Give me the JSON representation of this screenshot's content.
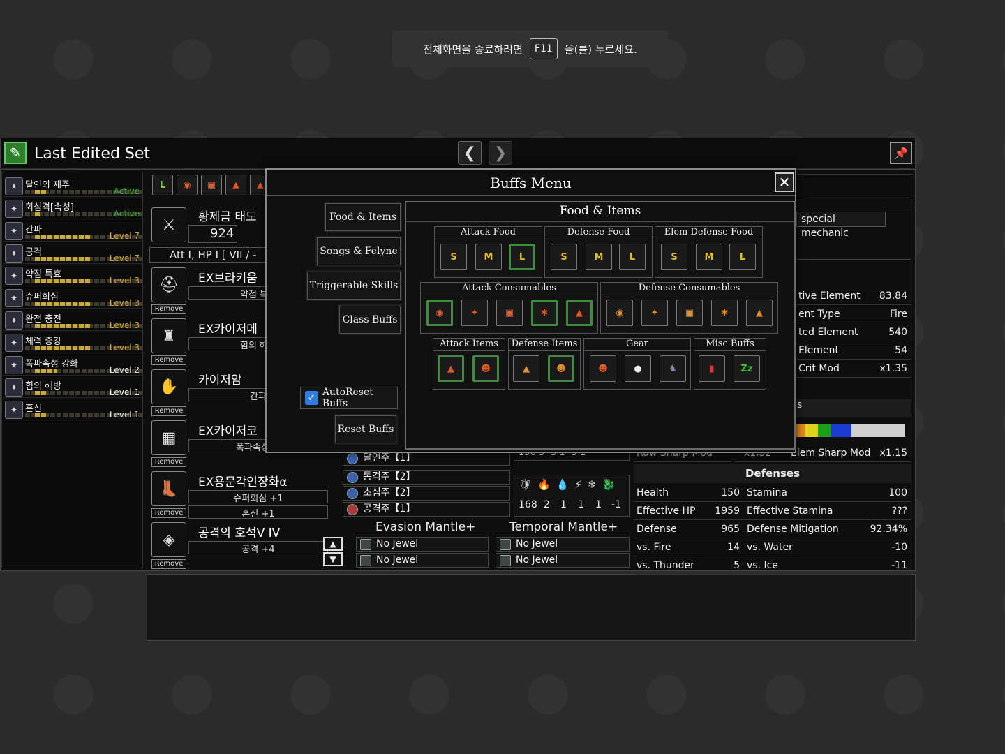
{
  "fullscreen_hint": {
    "before": "전체화면을 종료하려면",
    "key": "F11",
    "after": "을(를) 누르세요."
  },
  "window": {
    "title": "Last Edited Set",
    "prev": "❮",
    "next": "❯"
  },
  "skills": [
    {
      "name": "달인의 재주",
      "status": "Active",
      "fill": 0.2,
      "color": "#3ab03a"
    },
    {
      "name": "회심격[속성]",
      "status": "Active",
      "fill": 0.1,
      "color": "#3ab03a"
    },
    {
      "name": "간파",
      "status": "Level 7",
      "fill": 1.0,
      "color": "#d4a530"
    },
    {
      "name": "공격",
      "status": "Level 7",
      "fill": 1.0,
      "color": "#d4a530"
    },
    {
      "name": "약점 특효",
      "status": "Level 3",
      "fill": 1.0,
      "color": "#d4a530"
    },
    {
      "name": "슈퍼회심",
      "status": "Level 3",
      "fill": 1.0,
      "color": "#d4a530"
    },
    {
      "name": "완전 충전",
      "status": "Level 3",
      "fill": 1.0,
      "color": "#d4a530"
    },
    {
      "name": "체력 증강",
      "status": "Level 3",
      "fill": 1.0,
      "color": "#d4a530"
    },
    {
      "name": "폭파속성 강화",
      "status": "Level 2",
      "fill": 0.4,
      "color": "#e8e8e8"
    },
    {
      "name": "힘의 해방",
      "status": "Level 1",
      "fill": 0.2,
      "color": "#e8e8e8"
    },
    {
      "name": "혼신",
      "status": "Level 1",
      "fill": 0.2,
      "color": "#e8e8e8"
    }
  ],
  "weapon": {
    "name": "황제금 태도",
    "attack": "924",
    "att_row": "Att I, HP I [ VII / -"
  },
  "gear": [
    {
      "name": "EX브라키움",
      "skill1": "약점 특효",
      "skill2": ""
    },
    {
      "name": "EX카이저메",
      "skill1": "힘의 해방",
      "skill2": ""
    },
    {
      "name": "카이저암",
      "skill1": "간파",
      "skill2": ""
    },
    {
      "name": "EX카이저코",
      "skill1": "폭파속성 강",
      "skill2": ""
    },
    {
      "name": "EX용문각인장화α",
      "skill1": "슈퍼회심 +1",
      "skill2": "혼신 +1"
    },
    {
      "name": "공격의 호석V IV",
      "skill1": "공격 +4",
      "skill2": ""
    }
  ],
  "remove_label": "Remove",
  "jewels": [
    "달인주【1】",
    "통격주【2】",
    "초심주【2】",
    "공격주【1】"
  ],
  "mantles": {
    "m1": "Evasion Mantle+",
    "m2": "Temporal Mantle+",
    "no_jewel": "No Jewel"
  },
  "resist_row": [
    "168",
    "2",
    "1",
    "1",
    "1",
    "-1"
  ],
  "resist_partial": "156  3  -3  1  -3  1",
  "stats_top": [
    {
      "label": "tive Element",
      "value": "83.84"
    },
    {
      "label": "ent Type",
      "value": "Fire"
    },
    {
      "label": "ted Element",
      "value": "540"
    },
    {
      "label": "Element",
      "value": "54"
    },
    {
      "label": "Crit Mod",
      "value": "x1.35"
    }
  ],
  "special_mechanic": "special mechanic",
  "stats_sharp": {
    "label1": "Raw Sharp Mod",
    "value1": "x1.32",
    "label2": "Elem Sharp Mod",
    "value2": "x1.15"
  },
  "defenses_title": "Defenses",
  "defenses": [
    {
      "l1": "Health",
      "v1": "150",
      "l2": "Stamina",
      "v2": "100"
    },
    {
      "l1": "Effective HP",
      "v1": "1959",
      "l2": "Effective Stamina",
      "v2": "???"
    },
    {
      "l1": "Defense",
      "v1": "965",
      "l2": "Defense Mitigation",
      "v2": "92.34%"
    },
    {
      "l1": "vs. Fire",
      "v1": "14",
      "l2": "vs. Water",
      "v2": "-10"
    },
    {
      "l1": "vs. Thunder",
      "v1": "5",
      "l2": "vs. Ice",
      "v2": "-11"
    }
  ],
  "buffs": {
    "title": "Buffs Menu",
    "categories": [
      "Food & Items",
      "Songs & Felyne",
      "Triggerable Skills",
      "Class Buffs"
    ],
    "autoreset": "AutoReset Buffs",
    "reset": "Reset Buffs",
    "panel_title": "Food & Items",
    "groups": {
      "attack_food": "Attack Food",
      "defense_food": "Defense Food",
      "elem_defense_food": "Elem Defense Food",
      "attack_consumables": "Attack Consumables",
      "defense_consumables": "Defense Consumables",
      "attack_items": "Attack Items",
      "defense_items": "Defense Items",
      "gear": "Gear",
      "misc_buffs": "Misc Buffs"
    },
    "food_sizes": [
      "S",
      "M",
      "L"
    ]
  }
}
